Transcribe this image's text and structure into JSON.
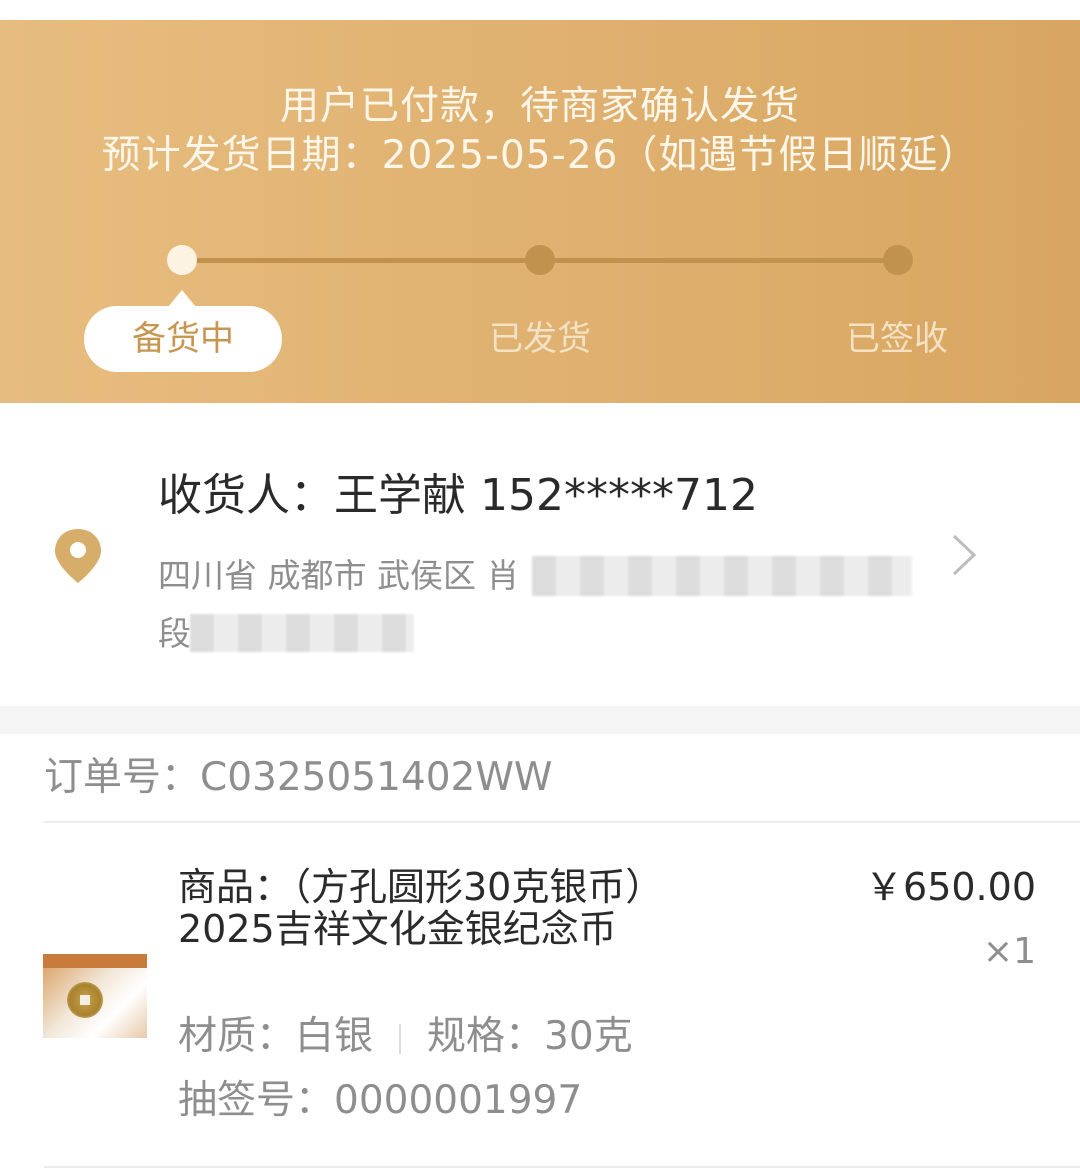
{
  "status": {
    "title": "用户已付款，待商家确认发货",
    "eta": "预计发货日期：2025-05-26（如遇节假日顺延）",
    "steps": [
      {
        "label": "备货中",
        "active": true
      },
      {
        "label": "已发货",
        "active": false
      },
      {
        "label": "已签收",
        "active": false
      }
    ]
  },
  "address": {
    "recipient_line": "收货人：王学献 152*****712",
    "address_line1_visible": "四川省 成都市 武侯区 肖",
    "address_line2_visible": "段"
  },
  "order": {
    "number_line": "订单号：C0325051402WW",
    "product": {
      "name": "商品：（方孔圆形30克银币）2025吉祥文化金银纪念币",
      "price": "￥650.00",
      "quantity": "×1",
      "material": "材质：白银",
      "spec": "规格：30克",
      "lottery": "抽签号：0000001997"
    }
  },
  "colors": {
    "header_gold": "#dfb06f",
    "active_text": "#c79650",
    "track": "#c0924d"
  }
}
